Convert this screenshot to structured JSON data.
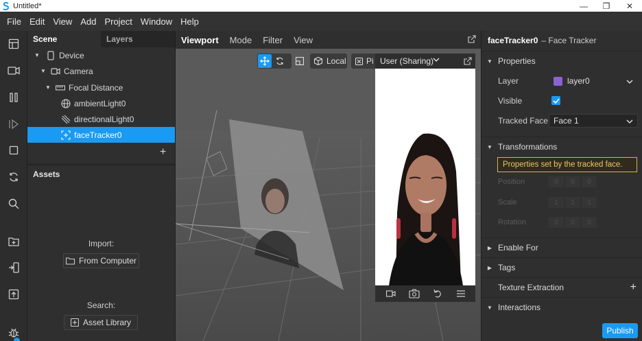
{
  "window": {
    "title": "Untitled*",
    "controls": [
      "—",
      "❐",
      "✕"
    ]
  },
  "menu": [
    "File",
    "Edit",
    "View",
    "Add",
    "Project",
    "Window",
    "Help"
  ],
  "left_tools": [
    "layout-icon",
    "camera-icon",
    "pause-icon",
    "play-step-icon",
    "stop-icon",
    "refresh-icon",
    "search-icon",
    "import-icon",
    "send-icon",
    "upload-icon",
    "bug-icon"
  ],
  "scene": {
    "tabs": [
      "Scene",
      "Layers"
    ],
    "tree": [
      {
        "label": "Device",
        "icon": "phone-icon"
      },
      {
        "label": "Camera",
        "icon": "camera-icon"
      },
      {
        "label": "Focal Distance",
        "icon": "ruler-icon"
      },
      {
        "label": "ambientLight0",
        "icon": "globe-icon"
      },
      {
        "label": "directionalLight0",
        "icon": "directional-light-icon"
      },
      {
        "label": "faceTracker0",
        "icon": "face-tracker-icon"
      }
    ],
    "add_label": "+"
  },
  "assets": {
    "title": "Assets",
    "import_label": "Import:",
    "from_computer": "From Computer",
    "search_label": "Search:",
    "asset_library": "Asset Library"
  },
  "viewport": {
    "tabs": [
      "Viewport",
      "Mode",
      "Filter",
      "View"
    ],
    "local_label": "Local",
    "pivot_label": "Pi"
  },
  "simulator": {
    "device_label": "User (Sharing)"
  },
  "inspector": {
    "object_name": "faceTracker0",
    "object_type": "– Face Tracker",
    "properties_label": "Properties",
    "layer_label": "Layer",
    "layer_value": "layer0",
    "layer_color": "#8a63d2",
    "visible_label": "Visible",
    "visible_checked": true,
    "tracked_face_label": "Tracked Face",
    "tracked_face_value": "Face 1",
    "transformations_label": "Transformations",
    "notice": "Properties set by the tracked face.",
    "position_label": "Position",
    "position_values": [
      "0",
      "0",
      "0"
    ],
    "scale_label": "Scale",
    "scale_values": [
      "1",
      "1",
      "1"
    ],
    "rotation_label": "Rotation",
    "rotation_values": [
      "0",
      "0",
      "0"
    ],
    "enable_for_label": "Enable For",
    "tags_label": "Tags",
    "texture_extraction_label": "Texture Extraction",
    "texture_extraction_add": "+",
    "interactions_label": "Interactions",
    "publish_label": "Publish"
  },
  "colors": {
    "accent": "#1a9af2",
    "notice_border": "#d7b54b",
    "notice_text": "#e8c76a"
  }
}
